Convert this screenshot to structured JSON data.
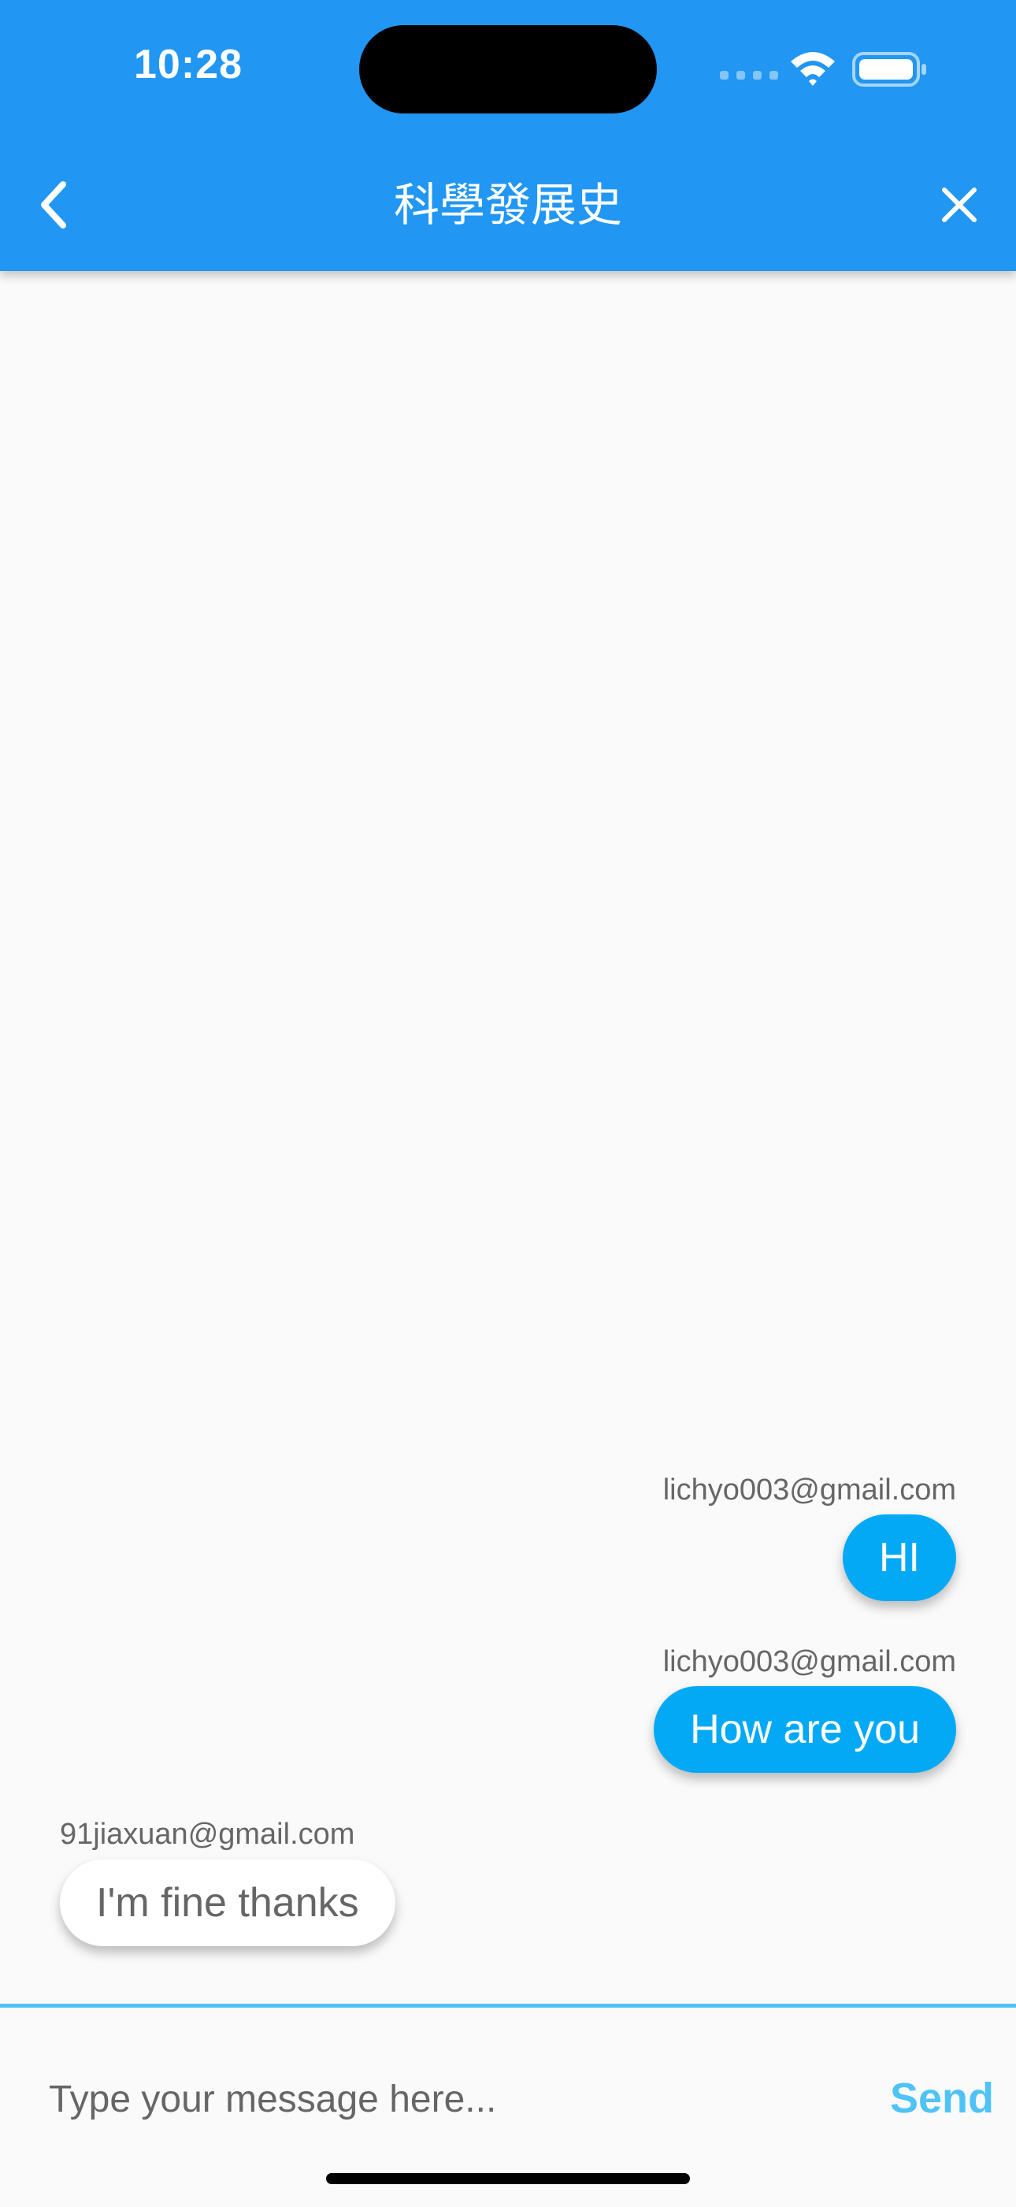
{
  "status_bar": {
    "time": "10:28",
    "icons": [
      "signal-icon",
      "wifi-icon",
      "battery-icon"
    ]
  },
  "header": {
    "title": "科學發展史",
    "back_icon": "chevron-left-icon",
    "close_icon": "close-icon"
  },
  "messages": [
    {
      "sender": "lichyo003@gmail.com",
      "text": "HI",
      "mine": true
    },
    {
      "sender": "lichyo003@gmail.com",
      "text": "How are you",
      "mine": true
    },
    {
      "sender": "91jiaxuan@gmail.com",
      "text": "I'm fine thanks",
      "mine": false
    }
  ],
  "composer": {
    "placeholder": "Type your message here...",
    "value": "",
    "send_label": "Send"
  },
  "colors": {
    "app_bar": "#2196f3",
    "my_bubble": "#03a9f4",
    "their_bubble": "#ffffff",
    "accent": "#4fc3f7",
    "background": "#fafafa"
  }
}
